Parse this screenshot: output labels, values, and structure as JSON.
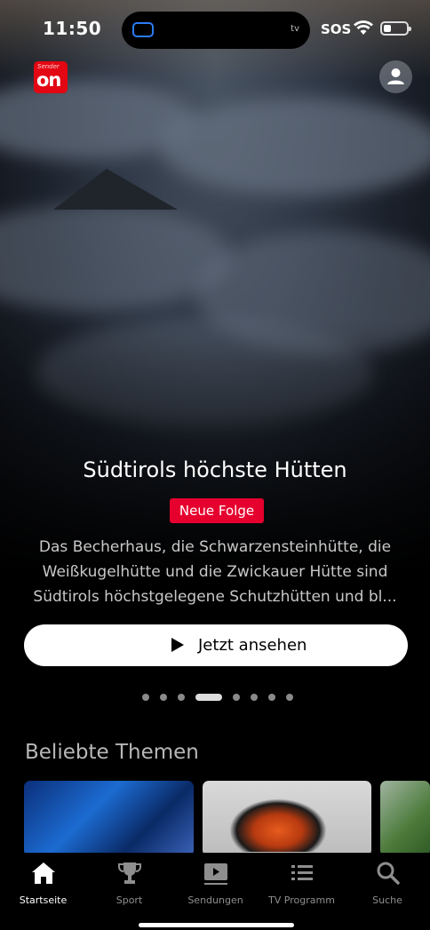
{
  "status": {
    "time": "11:50",
    "sos": "SOS",
    "island_label": "tv"
  },
  "brand": {
    "logo_top": "Sender",
    "logo_text": "on"
  },
  "hero": {
    "title": "Südtirols höchste Hütten",
    "badge": "Neue Folge",
    "description_line1": "Das Becherhaus, die Schwarzensteinhütte, die",
    "description_line2": "Weißkugelhütte und die Zwickauer Hütte sind",
    "description_line3": "Südtirols höchstgelegene Schutzhütten und bl...",
    "watch_label": "Jetzt ansehen"
  },
  "carousel": {
    "count": 8,
    "active_index": 3
  },
  "section": {
    "title": "Beliebte Themen"
  },
  "tabs": [
    {
      "label": "Startseite",
      "icon": "home-icon",
      "active": true
    },
    {
      "label": "Sport",
      "icon": "trophy-icon",
      "active": false
    },
    {
      "label": "Sendungen",
      "icon": "play-screen-icon",
      "active": false
    },
    {
      "label": "TV Programm",
      "icon": "list-icon",
      "active": false
    },
    {
      "label": "Suche",
      "icon": "search-icon",
      "active": false
    }
  ]
}
